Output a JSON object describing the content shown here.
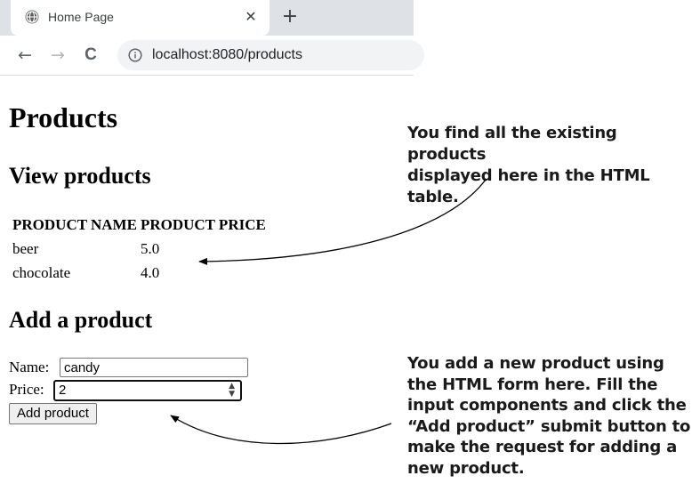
{
  "browser": {
    "tab_title": "Home Page",
    "tab_close": "✕",
    "new_tab": "+",
    "back": "←",
    "forward": "→",
    "reload": "C",
    "url": "localhost:8080/products"
  },
  "page": {
    "title": "Products",
    "view_section_title": "View products",
    "table": {
      "headers": [
        "PRODUCT NAME",
        "PRODUCT PRICE"
      ],
      "rows": [
        [
          "beer",
          "5.0"
        ],
        [
          "chocolate",
          "4.0"
        ]
      ]
    },
    "add_section_title": "Add a product",
    "form": {
      "name_label": "Name:",
      "name_value": "candy",
      "price_label": "Price:",
      "price_value": "2",
      "submit_label": "Add product"
    }
  },
  "annotations": {
    "table_note": [
      "You find all the existing products",
      "displayed here in the HTML table."
    ],
    "form_note": [
      "You add a new product using",
      "the HTML form here. Fill the",
      "input components and click the",
      "“Add product” submit button to",
      "make the request for adding a",
      "new product."
    ]
  }
}
